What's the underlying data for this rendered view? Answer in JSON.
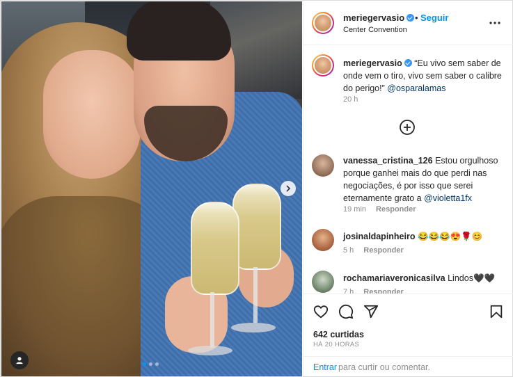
{
  "post": {
    "username": "meriegervasio",
    "location": "Center Convention",
    "follow_label": "Seguir",
    "separator": "•",
    "caption_text": "“Eu vivo sem saber de onde vem o tiro, vivo sem saber o calibre do perigo!”",
    "caption_mention": "@osparalamas",
    "caption_time": "20 h",
    "likes": "642 curtidas",
    "posted_ago": "HÁ 20 HORAS"
  },
  "carousel": {
    "slide_index": 1,
    "slide_count": 3
  },
  "comments": [
    {
      "username": "vanessa_cristina_126",
      "text": "Estou orgulhoso porque ganhei mais do que perdi nas negociações, é por isso que serei eternamente grato a",
      "mention": "@violetta1fx",
      "time": "19 min",
      "reply_label": "Responder"
    },
    {
      "username": "josinaldapinheiro",
      "text": "😂😂😂😍🌹😊",
      "time": "5 h",
      "reply_label": "Responder"
    },
    {
      "username": "rochamariaveronicasilva",
      "text": "Lindos🖤🖤",
      "time": "7 h",
      "reply_label": "Responder"
    }
  ],
  "footer": {
    "login_link": "Entrar",
    "login_text": "para curtir ou comentar."
  },
  "icons": {
    "more": "more-options-icon",
    "add_comment": "add-circle-icon",
    "like": "heart-icon",
    "comment": "comment-icon",
    "share": "send-icon",
    "save": "bookmark-icon",
    "next": "chevron-right-icon",
    "tag": "user-tag-icon"
  },
  "colors": {
    "accent": "#0095f6",
    "verified": "#3897f0",
    "muted": "#8e8e8e",
    "text": "#262626"
  }
}
